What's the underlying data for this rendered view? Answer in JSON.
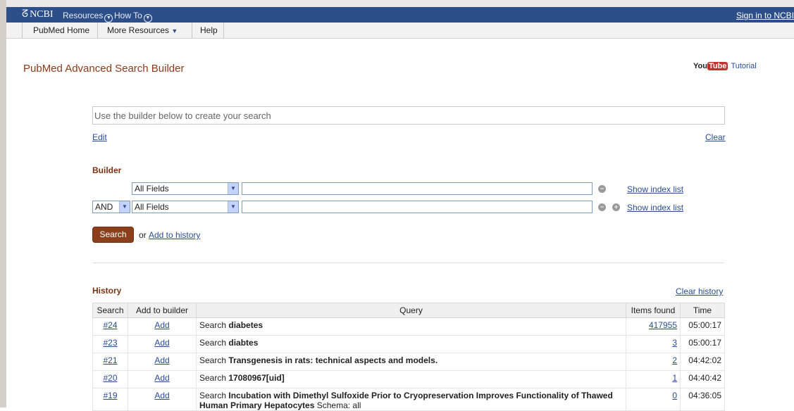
{
  "ncbi_bar": {
    "logo": "NCBI",
    "resources": "Resources",
    "howto": "How To",
    "signin": "Sign in to NCBI"
  },
  "pubmed_bar": {
    "home": "PubMed Home",
    "more": "More Resources",
    "help": "Help"
  },
  "page_title": "PubMed Advanced Search Builder",
  "youtube": {
    "you": "You",
    "tube": "Tube",
    "tutorial": "Tutorial"
  },
  "query_box": {
    "placeholder": "Use the builder below to create your search"
  },
  "edit_link": "Edit",
  "clear_link": "Clear",
  "builder": {
    "heading": "Builder",
    "rows": [
      {
        "operator": "",
        "field": "All Fields",
        "value": "",
        "index_link": "Show index list"
      },
      {
        "operator": "AND",
        "field": "All Fields",
        "value": "",
        "index_link": "Show index list"
      }
    ]
  },
  "search_button": "Search",
  "or_text": "or",
  "add_to_history": "Add to history",
  "history": {
    "heading": "History",
    "clear_link": "Clear history",
    "columns": [
      "Search",
      "Add to builder",
      "Query",
      "Items found",
      "Time"
    ],
    "rows": [
      {
        "id": "#24",
        "add": "Add",
        "prefix": "Search",
        "term": "diabetes",
        "suffix": "",
        "items": "417955",
        "time": "05:00:17"
      },
      {
        "id": "#23",
        "add": "Add",
        "prefix": "Search",
        "term": "diabtes",
        "suffix": "",
        "items": "3",
        "time": "05:00:17"
      },
      {
        "id": "#21",
        "add": "Add",
        "prefix": "Search",
        "term": "Transgenesis in rats: technical aspects and models.",
        "suffix": "",
        "items": "2",
        "time": "04:42:02"
      },
      {
        "id": "#20",
        "add": "Add",
        "prefix": "Search",
        "term": "17080967[uid]",
        "suffix": "",
        "items": "1",
        "time": "04:40:42"
      },
      {
        "id": "#19",
        "add": "Add",
        "prefix": "Search",
        "term": "Incubation with Dimethyl Sulfoxide Prior to Cryopreservation Improves Functionality of Thawed Human Primary Hepatocytes",
        "suffix": " Schema: all",
        "items": "0",
        "time": "04:36:05"
      }
    ]
  }
}
